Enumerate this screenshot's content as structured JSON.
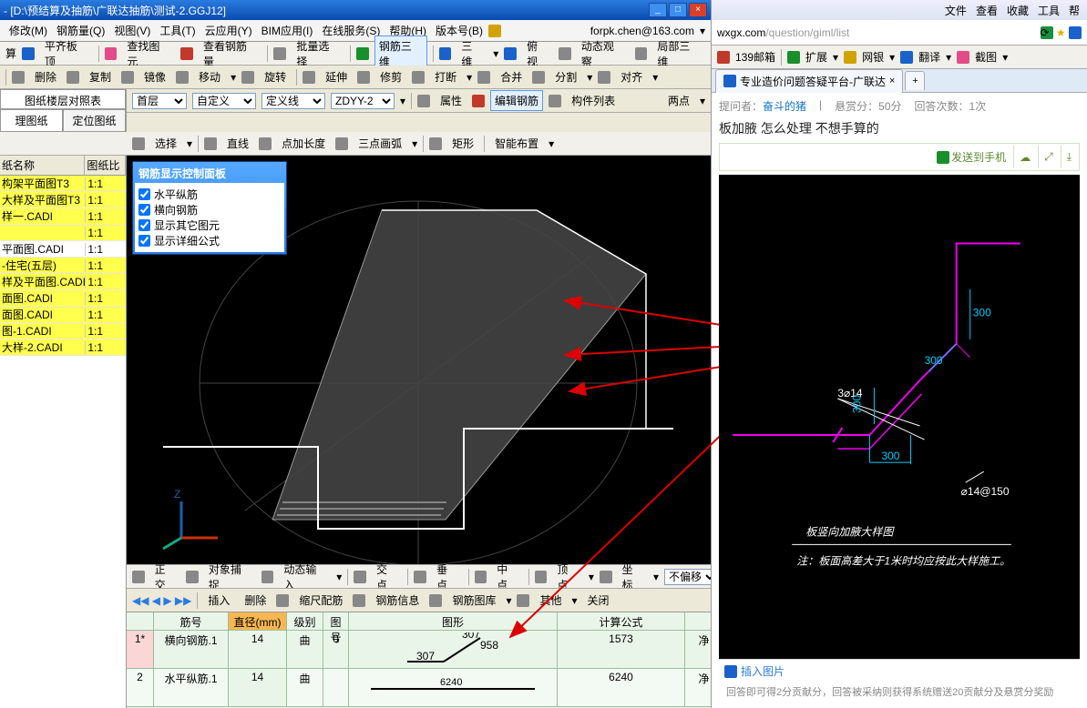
{
  "window": {
    "title": "- [D:\\预结算及抽筋\\广联达抽筋\\测试-2.GGJ12]",
    "user": "forpk.chen@163.com"
  },
  "menu": [
    "修改(M)",
    "钢筋量(Q)",
    "视图(V)",
    "工具(T)",
    "云应用(Y)",
    "BIM应用(I)",
    "在线服务(S)",
    "帮助(H)",
    "版本号(B)"
  ],
  "tb1": {
    "pqbd": "平齐板顶",
    "search": "查找图元",
    "view": "查看钢筋量",
    "batch": "批量选择",
    "g3d": "钢筋三维",
    "sw": "三维",
    "bird": "俯视",
    "dyn": "动态观察",
    "local": "局部三维"
  },
  "tb2": {
    "del": "删除",
    "copy": "复制",
    "mirror": "镜像",
    "move": "移动",
    "rotate": "旋转",
    "extend": "延伸",
    "trim": "修剪",
    "break": "打断",
    "align": "合并",
    "split": "分割",
    "offset": "对齐"
  },
  "tb3": {
    "first": "首层",
    "custom": "自定义",
    "yx": "定义线",
    "zdyy": "ZDYY-2",
    "attrs": "属性",
    "editGJ": "编辑钢筋",
    "cjlist": "构件列表",
    "2pt": "两点"
  },
  "tb4": {
    "select": "选择",
    "line": "直线",
    "ptLine": "点加长度",
    "arc3": "三点画弧",
    "rect": "矩形",
    "smart": "智能布置"
  },
  "floor_tab": "图纸楼层对照表",
  "side_tabs": {
    "a": "理图纸",
    "b": "定位图纸"
  },
  "side_header": {
    "name": "纸名称",
    "ratio": "图纸比"
  },
  "dwgs": [
    {
      "n": "构架平面图T3",
      "r": "1:1",
      "hl": true
    },
    {
      "n": "大样及平面图T3",
      "r": "1:1",
      "hl": true
    },
    {
      "n": "样一.CADI",
      "r": "1:1",
      "hl": true
    },
    {
      "n": "",
      "r": "1:1",
      "hl": true
    },
    {
      "n": "平面图.CADI",
      "r": "1:1",
      "hl": false
    },
    {
      "n": "-住宅(五层)",
      "r": "1:1",
      "hl": true
    },
    {
      "n": "样及平面图.CADI",
      "r": "1:1",
      "hl": true
    },
    {
      "n": "面图.CADI",
      "r": "1:1",
      "hl": true
    },
    {
      "n": "面图.CADI",
      "r": "1:1",
      "hl": true
    },
    {
      "n": "图-1.CADI",
      "r": "1:1",
      "hl": true
    },
    {
      "n": "大样-2.CADI",
      "r": "1:1",
      "hl": true
    }
  ],
  "ctrl_panel": {
    "title": "钢筋显示控制面板",
    "items": [
      "水平纵筋",
      "横向钢筋",
      "显示其它图元",
      "显示详细公式"
    ]
  },
  "status": {
    "ortho": "正交",
    "snap": "对象捕捉",
    "dyn": "动态输入",
    "jd": "交点",
    "cd": "垂点",
    "zd": "中点",
    "dd": "顶点",
    "zb": "坐标",
    "bps": "不偏移"
  },
  "mid": {
    "insert": "插入",
    "del": "删除",
    "sjpj": "缩尺配筋",
    "gjxx": "钢筋信息",
    "gjtk": "钢筋图库",
    "other": "其他",
    "close": "关闭"
  },
  "rt_header": {
    "idx": "",
    "jh": "筋号",
    "dia": "直径(mm)",
    "jb": "级别",
    "th": "图号",
    "tx": "图形",
    "gs": "计算公式",
    "ed": ""
  },
  "rt_rows": [
    {
      "idx": "1*",
      "jh": "横向钢筋.1",
      "dia": "14",
      "jb": "曲",
      "th": "0",
      "l1": "307",
      "l2": "307",
      "mid": "958",
      "gs": "1573",
      "ed": "净",
      "red": true
    },
    {
      "idx": "2",
      "jh": "水平纵筋.1",
      "dia": "14",
      "jb": "曲",
      "th": "",
      "l1": "",
      "l2": "",
      "mid": "6240",
      "gs": "6240",
      "ed": "净",
      "red": false,
      "midred": true
    }
  ],
  "browser": {
    "menus": [
      "文件",
      "查看",
      "收藏",
      "工具",
      "帮"
    ],
    "url_pre": "wxgx.com",
    "url_rest": "/question/giml/list",
    "tbitems": {
      "mail": "139邮箱",
      "ext": "扩展",
      "wy": "网银",
      "fy": "翻译",
      "jt": "截图"
    },
    "tab": "专业造价问题答疑平台-广联达",
    "asker_lbl": "提问者：",
    "asker": "奋斗的猪",
    "bounty": "悬赏分：50分",
    "answers": "回答次数：1次",
    "q_title": "板加腋 怎么处理 不想手算的",
    "send": "发送到手机",
    "dia": {
      "d300a": "300",
      "d300b": "300",
      "d300c": "300",
      "bar": "3⌀14",
      "bar2": "⌀14@150",
      "caption": "板竖向加腋大样图",
      "note": "注：板面高差大于1米时均应按此大样施工。"
    },
    "attach": "插入图片",
    "foot": "回答即可得2分贡献分，回答被采纳则获得系统赠送20贡献分及悬赏分奖励"
  }
}
